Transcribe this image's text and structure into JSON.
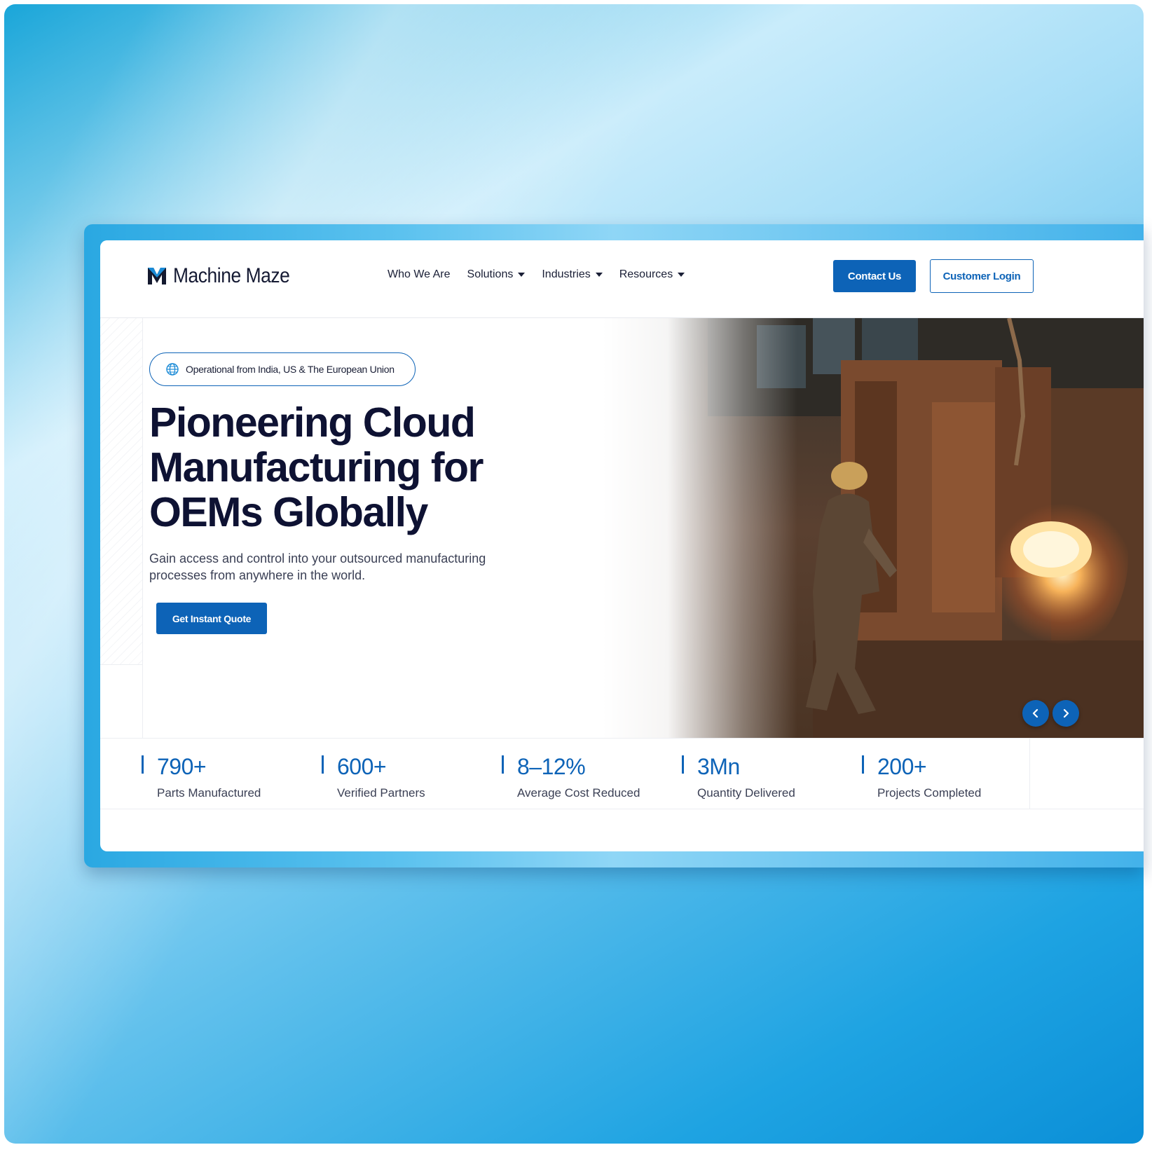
{
  "site": {
    "brand": "Machine Maze",
    "nav": [
      {
        "label": "Who We Are"
      },
      {
        "label": "Solutions"
      },
      {
        "label": "Industries"
      },
      {
        "label": "Resources"
      }
    ],
    "contact_label": "Contact Us",
    "login_label": "Customer Login"
  },
  "hero": {
    "badge": "Operational from India, US & The European Union",
    "badge_icon": "globe-icon",
    "headline": "Pioneering Cloud Manufacturing for OEMs Globally",
    "subtext": "Gain access and control into your outsourced manufacturing processes from anywhere in the world.",
    "cta_label": "Get Instant Quote",
    "carousel_prev_icon": "chevron-left-icon",
    "carousel_next_icon": "chevron-right-icon"
  },
  "stats": [
    {
      "value": "790+",
      "label": "Parts Manufactured"
    },
    {
      "value": "600+",
      "label": "Verified Partners"
    },
    {
      "value": "8–12%",
      "label": "Average Cost Reduced"
    },
    {
      "value": "3Mn",
      "label": "Quantity Delivered"
    },
    {
      "value": "200+",
      "label": "Projects Completed"
    }
  ],
  "colors": {
    "accent": "#0d63b7",
    "heading": "#0e1233",
    "background": "#1ea3e2"
  }
}
